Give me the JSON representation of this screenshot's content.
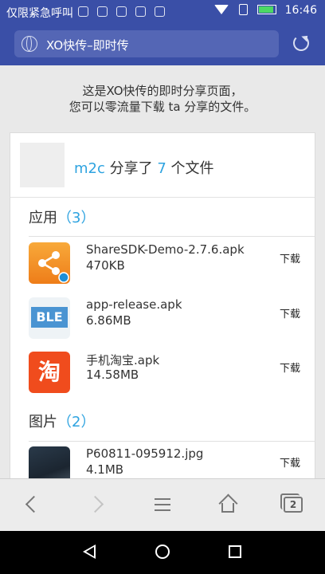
{
  "status_bar": {
    "carrier": "仅限紧急呼叫",
    "time": "16:46",
    "icons": [
      "notification-icon-1",
      "notification-icon-2",
      "notification-icon-3",
      "notification-icon-4",
      "notification-icon-5"
    ]
  },
  "browser": {
    "url_title": "XO快传–即时传"
  },
  "page": {
    "intro_line1": "这是XO快传的即时分享页面，",
    "intro_line2": "您可以零流量下载 ta 分享的文件。",
    "sharer": "m2c",
    "share_text_pre": "分享了",
    "file_count": "7",
    "share_text_post": "个文件"
  },
  "categories": [
    {
      "label": "应用",
      "count_text": "（3）",
      "items": [
        {
          "name": "ShareSDK-Demo-2.7.6.apk",
          "size": "470KB",
          "download": "下载",
          "icon": "sharesdk-app-icon"
        },
        {
          "name": "app-release.apk",
          "size": "6.86MB",
          "download": "下载",
          "icon": "ble-app-icon",
          "icon_text": "BLE"
        },
        {
          "name": "手机淘宝.apk",
          "size": "14.58MB",
          "download": "下载",
          "icon": "taobao-app-icon",
          "icon_text": "淘"
        }
      ]
    },
    {
      "label": "图片",
      "count_text": "（2）",
      "items": [
        {
          "name": "P60811-095912.jpg",
          "size": "4.1MB",
          "download": "下载",
          "icon": "photo-thumbnail"
        }
      ]
    }
  ],
  "colors": {
    "header": "#3a4fa7",
    "accent": "#2ea3e0"
  }
}
